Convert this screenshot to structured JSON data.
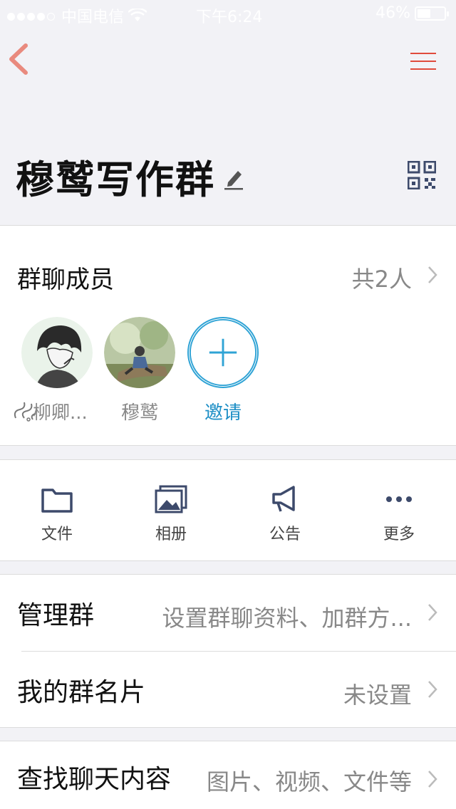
{
  "status_bar": {
    "carrier": "中国电信",
    "time": "下午6:24",
    "battery": "46%",
    "battery_level": 0.46
  },
  "header": {
    "group_name": "穆鹫写作群"
  },
  "members_section": {
    "title": "群聊成员",
    "count": "共2人",
    "members": [
      {
        "name": "柳卿..."
      },
      {
        "name": "穆鹫"
      }
    ],
    "invite_label": "邀请"
  },
  "actions": [
    {
      "label": "文件",
      "icon": "folder-icon"
    },
    {
      "label": "相册",
      "icon": "album-icon"
    },
    {
      "label": "公告",
      "icon": "megaphone-icon"
    },
    {
      "label": "更多",
      "icon": "more-icon"
    }
  ],
  "settings": {
    "manage_group": {
      "label": "管理群",
      "value": "设置群聊资料、加群方..."
    },
    "my_card": {
      "label": "我的群名片",
      "value": "未设置"
    },
    "search_chat": {
      "label": "查找聊天内容",
      "value": "图片、视频、文件等"
    }
  },
  "colors": {
    "accent": "#e04b3c",
    "link": "#1e8fc6",
    "background": "#f2f2f6"
  }
}
